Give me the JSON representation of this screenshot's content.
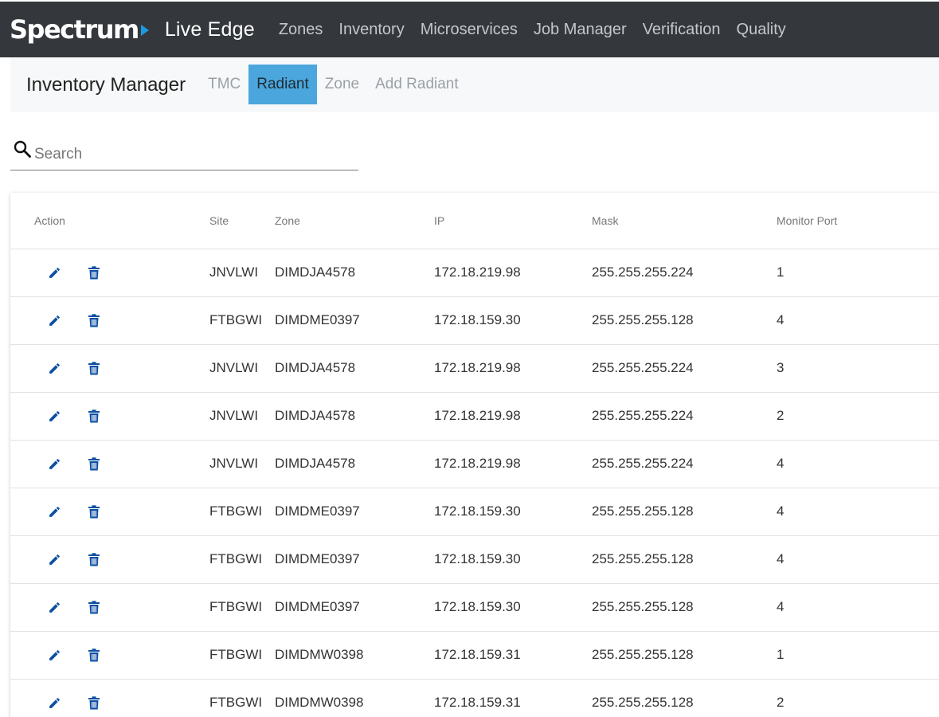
{
  "header": {
    "brand": "Spectrum",
    "app_name": "Live Edge",
    "nav": [
      "Zones",
      "Inventory",
      "Microservices",
      "Job Manager",
      "Verification",
      "Quality"
    ]
  },
  "subheader": {
    "title": "Inventory Manager",
    "tabs": [
      {
        "label": "TMC",
        "active": false
      },
      {
        "label": "Radiant",
        "active": true
      },
      {
        "label": "Zone",
        "active": false
      },
      {
        "label": "Add Radiant",
        "active": false
      }
    ]
  },
  "search": {
    "placeholder": "Search",
    "value": ""
  },
  "table": {
    "columns": [
      "Action",
      "Site",
      "Zone",
      "IP",
      "Mask",
      "Monitor Port"
    ],
    "rows": [
      {
        "site": "JNVLWI",
        "zone": "DIMDJA4578",
        "ip": "172.18.219.98",
        "mask": "255.255.255.224",
        "port": "1"
      },
      {
        "site": "FTBGWI",
        "zone": "DIMDME0397",
        "ip": "172.18.159.30",
        "mask": "255.255.255.128",
        "port": "4"
      },
      {
        "site": "JNVLWI",
        "zone": "DIMDJA4578",
        "ip": "172.18.219.98",
        "mask": "255.255.255.224",
        "port": "3"
      },
      {
        "site": "JNVLWI",
        "zone": "DIMDJA4578",
        "ip": "172.18.219.98",
        "mask": "255.255.255.224",
        "port": "2"
      },
      {
        "site": "JNVLWI",
        "zone": "DIMDJA4578",
        "ip": "172.18.219.98",
        "mask": "255.255.255.224",
        "port": "4"
      },
      {
        "site": "FTBGWI",
        "zone": "DIMDME0397",
        "ip": "172.18.159.30",
        "mask": "255.255.255.128",
        "port": "4"
      },
      {
        "site": "FTBGWI",
        "zone": "DIMDME0397",
        "ip": "172.18.159.30",
        "mask": "255.255.255.128",
        "port": "4"
      },
      {
        "site": "FTBGWI",
        "zone": "DIMDME0397",
        "ip": "172.18.159.30",
        "mask": "255.255.255.128",
        "port": "4"
      },
      {
        "site": "FTBGWI",
        "zone": "DIMDMW0398",
        "ip": "172.18.159.31",
        "mask": "255.255.255.128",
        "port": "1"
      },
      {
        "site": "FTBGWI",
        "zone": "DIMDMW0398",
        "ip": "172.18.159.31",
        "mask": "255.255.255.128",
        "port": "2"
      }
    ],
    "row_icons": [
      "pencil-icon",
      "trash-icon"
    ]
  },
  "colors": {
    "topbar": "#34383d",
    "brand_accent": "#1a9be0",
    "active_tab": "#4aa6dd",
    "action_icon": "#0d4fa3"
  }
}
